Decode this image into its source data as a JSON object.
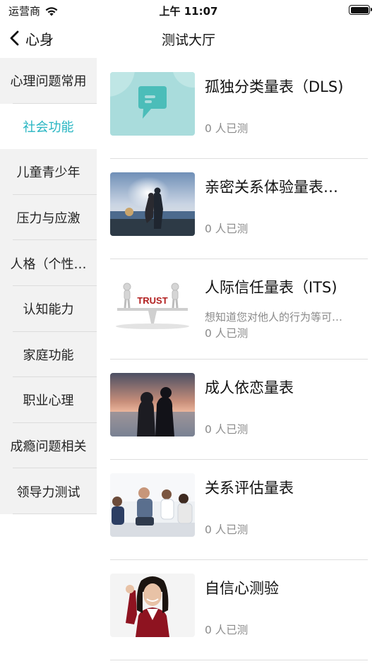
{
  "status_bar": {
    "carrier": "运营商",
    "time": "上午 11:07"
  },
  "nav": {
    "back_label": "心身",
    "title": "测试大厅"
  },
  "sidebar": {
    "items": [
      {
        "label": "心理问题常用",
        "active": false
      },
      {
        "label": "社会功能",
        "active": true
      },
      {
        "label": "儿童青少年",
        "active": false
      },
      {
        "label": "压力与应激",
        "active": false
      },
      {
        "label": "人格（个性…",
        "active": false
      },
      {
        "label": "认知能力",
        "active": false
      },
      {
        "label": "家庭功能",
        "active": false
      },
      {
        "label": "职业心理",
        "active": false
      },
      {
        "label": "成瘾问题相关",
        "active": false
      },
      {
        "label": "领导力测试",
        "active": false
      }
    ],
    "active_color": "#26b5c2"
  },
  "tests": [
    {
      "title": "孤独分类量表（DLS)",
      "desc": "",
      "count": "0 人已测",
      "image": "chat-bubble-icon"
    },
    {
      "title": "亲密关系体验量表…",
      "desc": "",
      "count": "0 人已测",
      "image": "couple-beach-photo"
    },
    {
      "title": "人际信任量表（ITS)",
      "desc": "想知道您对他人的行为等可…",
      "count": "0 人已测",
      "image": "trust-seesaw-image",
      "trust_word": "TRUST"
    },
    {
      "title": "成人依恋量表",
      "desc": "",
      "count": "0 人已测",
      "image": "couple-sunset-photo"
    },
    {
      "title": "关系评估量表",
      "desc": "",
      "count": "0 人已测",
      "image": "group-meeting-photo"
    },
    {
      "title": "自信心测验",
      "desc": "",
      "count": "0 人已测",
      "image": "confident-girl-photo"
    }
  ]
}
